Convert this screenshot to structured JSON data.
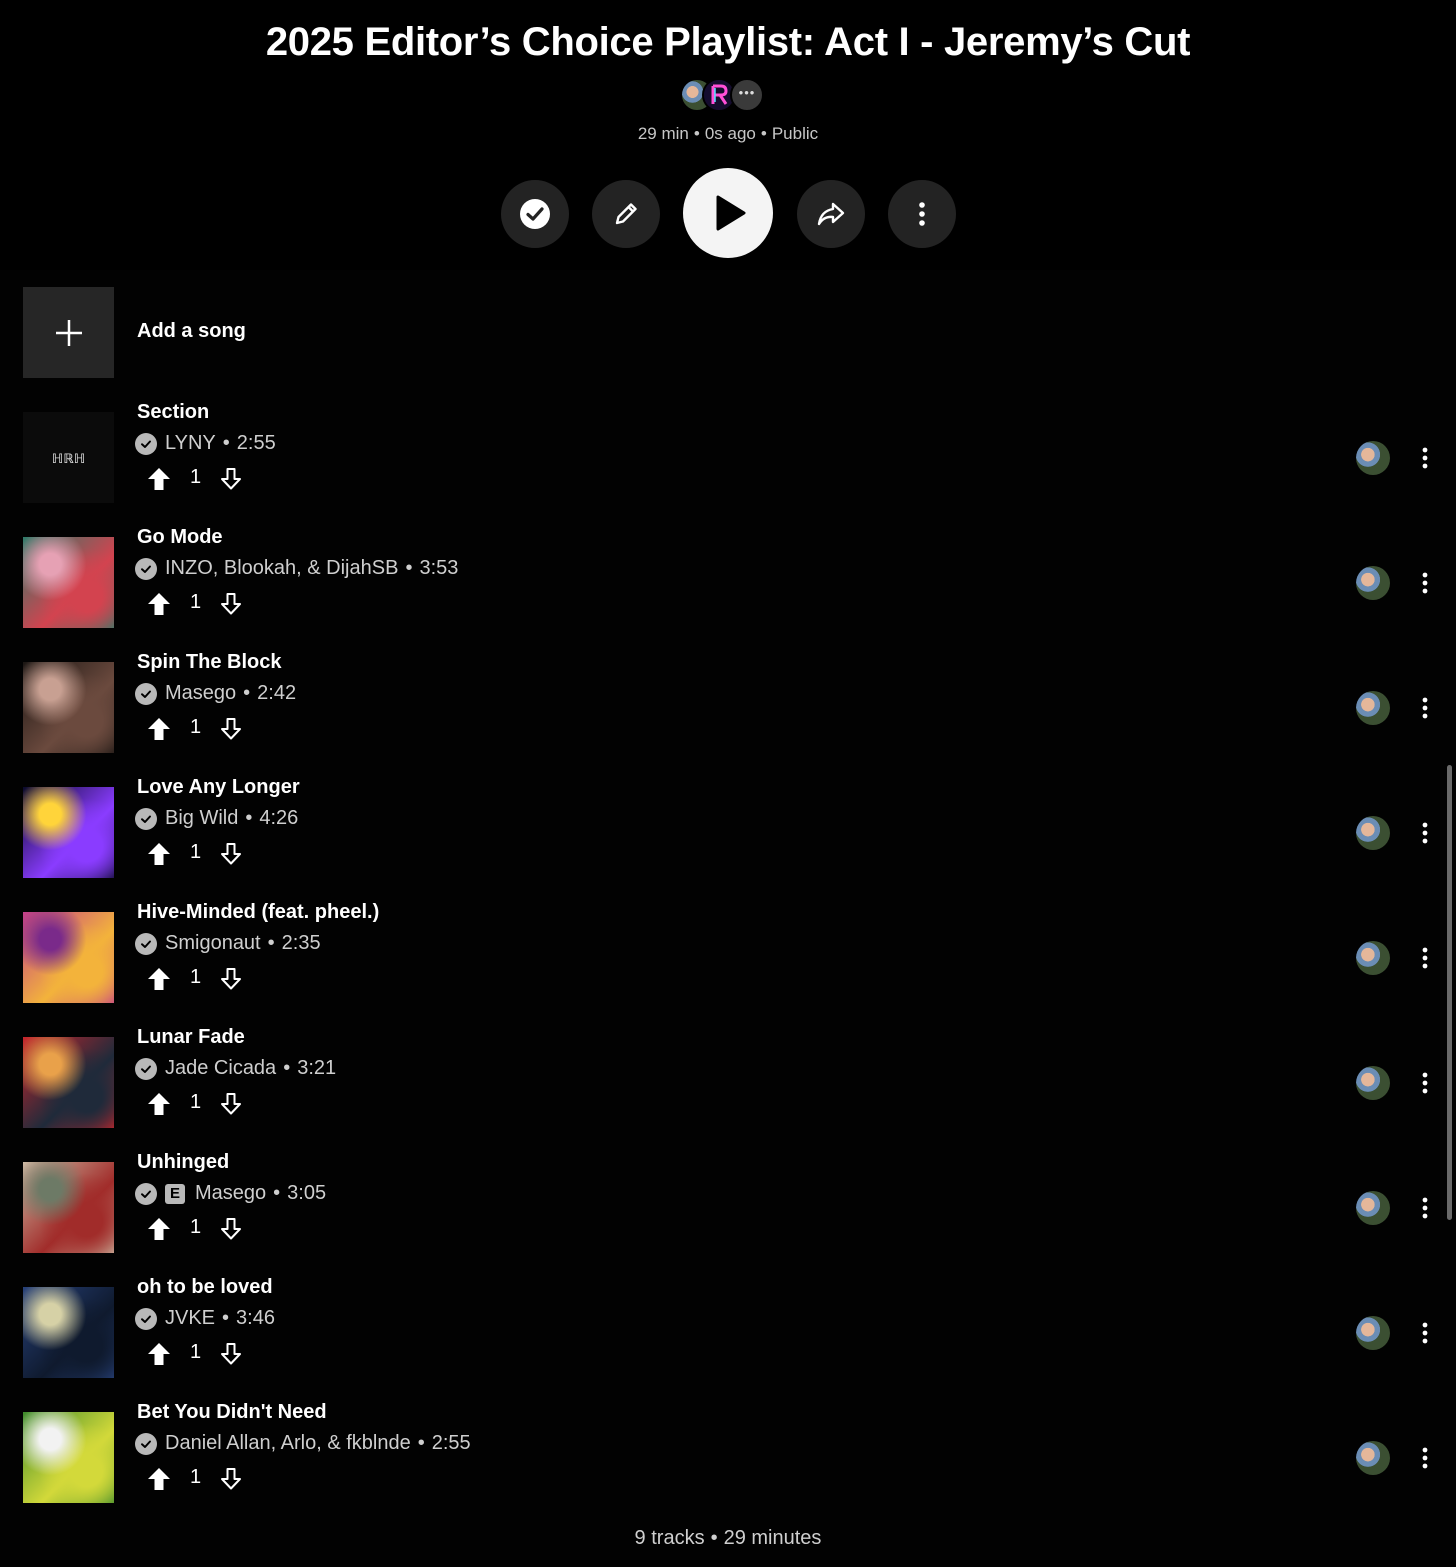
{
  "playlist": {
    "title": "2025 Editor’s Choice Playlist: Act I - Jeremy’s Cut",
    "duration": "29 min",
    "updated": "0s ago",
    "visibility": "Public"
  },
  "collaborators": {
    "more_label": "•••"
  },
  "icons": {
    "saved": "check-circle-icon",
    "edit": "pencil-icon",
    "play": "play-icon",
    "share": "share-arrow-icon",
    "more": "vertical-dots-icon",
    "add": "plus-icon",
    "upvote": "arrow-up-filled-icon",
    "downvote": "arrow-down-outline-icon"
  },
  "add_song": {
    "label": "Add a song"
  },
  "tracks": [
    {
      "title": "Section",
      "artist": "LYNY",
      "duration": "2:55",
      "votes": "1",
      "explicit": false,
      "art_colors": [
        "#050505",
        "#0b0b0b",
        "#d8d8d8"
      ]
    },
    {
      "title": "Go Mode",
      "artist": "INZO, Blookah, & DijahSB",
      "duration": "3:53",
      "votes": "1",
      "explicit": false,
      "art_colors": [
        "#2f7b6a",
        "#d3434f",
        "#e6a1b4"
      ]
    },
    {
      "title": "Spin The Block",
      "artist": "Masego",
      "duration": "2:42",
      "votes": "1",
      "explicit": false,
      "art_colors": [
        "#1b1613",
        "#6b4a3e",
        "#c8a092"
      ]
    },
    {
      "title": "Love Any Longer",
      "artist": "Big Wild",
      "duration": "4:26",
      "votes": "1",
      "explicit": false,
      "art_colors": [
        "#0a0a2a",
        "#8a3cff",
        "#ffd43a"
      ]
    },
    {
      "title": "Hive-Minded (feat. pheel.)",
      "artist": "Smigonaut",
      "duration": "2:35",
      "votes": "1",
      "explicit": false,
      "art_colors": [
        "#c23e8a",
        "#f3b33b",
        "#7a2a8a"
      ]
    },
    {
      "title": "Lunar Fade",
      "artist": "Jade Cicada",
      "duration": "3:21",
      "votes": "1",
      "explicit": false,
      "art_colors": [
        "#c8262c",
        "#1f2a3a",
        "#e9a14a"
      ]
    },
    {
      "title": "Unhinged",
      "artist": "Masego",
      "duration": "3:05",
      "votes": "1",
      "explicit": true,
      "explicit_label": "E",
      "art_colors": [
        "#cbb9a3",
        "#a12c2a",
        "#6d7a66"
      ]
    },
    {
      "title": "oh to be loved",
      "artist": "JVKE",
      "duration": "3:46",
      "votes": "1",
      "explicit": false,
      "art_colors": [
        "#27417a",
        "#0f1a2e",
        "#d6d1a6"
      ]
    },
    {
      "title": "Bet You Didn't Need",
      "artist": "Daniel Allan, Arlo, & fkblnde",
      "duration": "2:55",
      "votes": "1",
      "explicit": false,
      "art_colors": [
        "#3d8a2b",
        "#d3d93a",
        "#f2f2f2"
      ]
    }
  ],
  "footer": {
    "tracks": "9 tracks",
    "minutes": "29 minutes"
  }
}
